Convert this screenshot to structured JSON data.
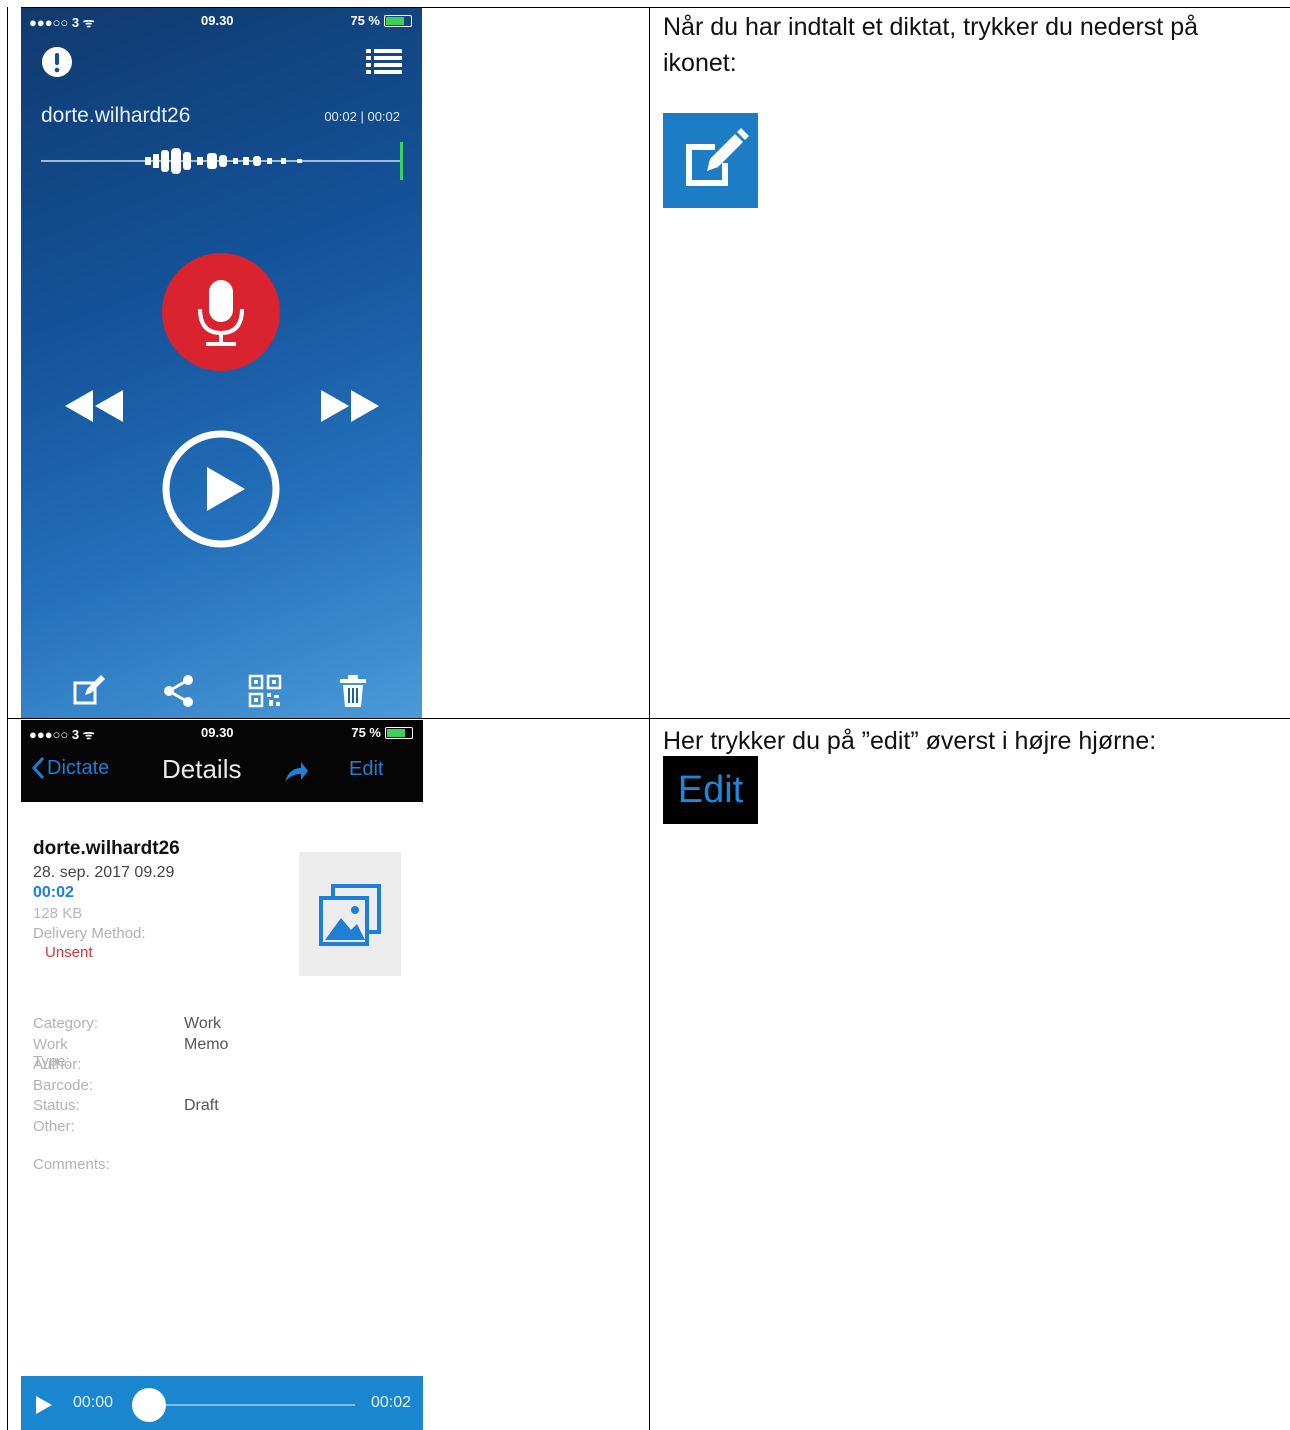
{
  "instructions": {
    "step1": "Når du har indtalt et diktat, trykker du nederst på ikonet:",
    "step2": "Her trykker du på ”edit” øverst i højre hjørne:",
    "edit_word": "Edit"
  },
  "screen1": {
    "status": {
      "signal": "●●●○○ 3 ᯤ",
      "time": "09.30",
      "battery": "75 %"
    },
    "recording": {
      "name": "dorte.wilhardt26",
      "time": "00:02 | 00:02"
    },
    "icons": {
      "top_left": "alert-icon",
      "top_right": "list-icon",
      "main": "microphone-icon",
      "left": "rewind-icon",
      "right": "fast-forward-icon",
      "play": "play-icon",
      "toolbar": [
        "edit-icon",
        "share-icon",
        "qr-code-icon",
        "trash-icon"
      ]
    },
    "colors": {
      "record": "#d9232e",
      "accent": "#3bd15b"
    }
  },
  "screen2": {
    "status": {
      "signal": "●●●○○ 3 ᯤ",
      "time": "09.30",
      "battery": "75 %"
    },
    "nav": {
      "back_label": "Dictate",
      "title": "Details",
      "edit_label": "Edit"
    },
    "details": {
      "name": "dorte.wilhardt26",
      "date": "28. sep. 2017 09.29",
      "duration": "00:02",
      "size": "128 KB",
      "delivery_label": "Delivery Method:",
      "delivery_status": "Unsent"
    },
    "fields": [
      {
        "label": "Category:",
        "value": "Work"
      },
      {
        "label": "Work Type:",
        "value": "Memo"
      },
      {
        "label": "Author:",
        "value": ""
      },
      {
        "label": "Barcode:",
        "value": ""
      },
      {
        "label": "Status:",
        "value": "Draft"
      },
      {
        "label": "Other:",
        "value": ""
      }
    ],
    "comments_label": "Comments:",
    "player": {
      "current": "00:00",
      "total": "00:02",
      "progress": 0.0
    }
  }
}
